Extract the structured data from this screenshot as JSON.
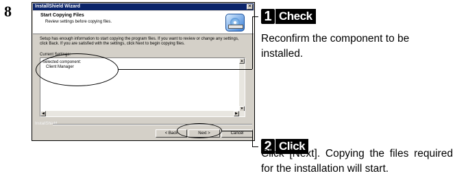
{
  "step_number": "8",
  "dialog": {
    "title": "InstallShield Wizard",
    "close_glyph": "✕",
    "header_title": "Start Copying Files",
    "header_subtitle": "Review settings before copying files.",
    "body_text": "Setup has enough information to start copying the program files.  If you want to review or change any settings, click Back.  If you are satisfied with the settings, click Next to begin copying files.",
    "settings_label": "Current Settings:",
    "settings_line1": "Selected component:",
    "settings_line2": "Client Manager",
    "brand_label": "InstallShield",
    "back_button": "< Back",
    "next_button": "Next >",
    "cancel_button": "Cancel"
  },
  "callouts": [
    {
      "number": "1",
      "word": "Check",
      "text": "Reconfirm the component to be installed."
    },
    {
      "number": "2",
      "word": "Click",
      "text": "Click [Next].  Copying the files required for the installation will start."
    }
  ]
}
